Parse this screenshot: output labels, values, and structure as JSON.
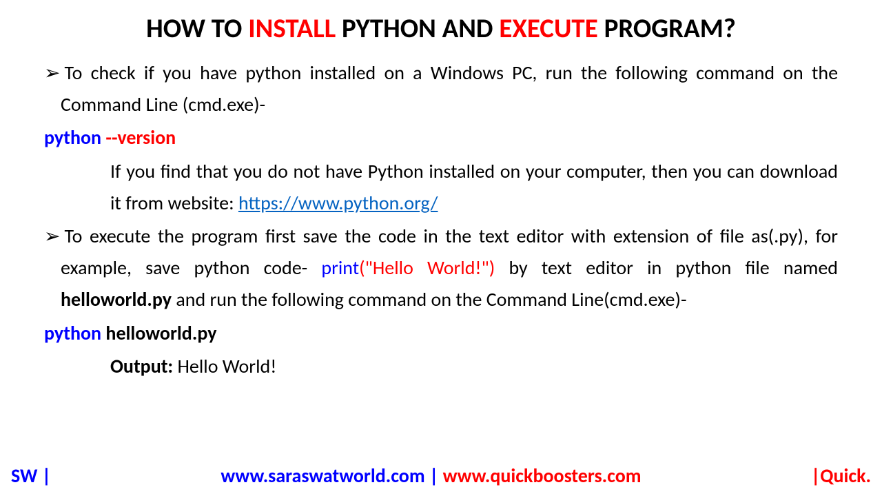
{
  "title": {
    "part1": "HOW TO ",
    "red1": "INSTALL",
    "part2": " PYTHON AND ",
    "red2": "EXECUTE",
    "part3": " PROGRAM?"
  },
  "bullet_marker": "➢",
  "bullet1_text": "To check if you have python installed on a Windows PC, run the following command on the Command Line (cmd.exe)-",
  "cmd1": {
    "blue": "python ",
    "red": "--version"
  },
  "subtext1_part1": "If you find that you do not have Python installed on your computer, then you can download it from website: ",
  "link_text": "https://www.python.org/",
  "bullet2_part1": "To execute the program first save the code in the text editor with extension of file as(.py), for example, save python code- ",
  "bullet2_print_blue": "print",
  "bullet2_print_red": "(\"Hello World!\")",
  "bullet2_part2": " by text editor in python file named ",
  "bullet2_filename": "helloworld.py",
  "bullet2_part3": " and run the following command on the Command Line(cmd.exe)-",
  "cmd2": {
    "blue": "python",
    "black": " helloworld.py"
  },
  "output": {
    "label": "Output: ",
    "value": "Hello World!"
  },
  "footer": {
    "left": "SW |",
    "center_blue": "www.saraswatworld.com",
    "center_sep": " | ",
    "center_red": "www.quickboosters.com",
    "right": "|Quick."
  }
}
